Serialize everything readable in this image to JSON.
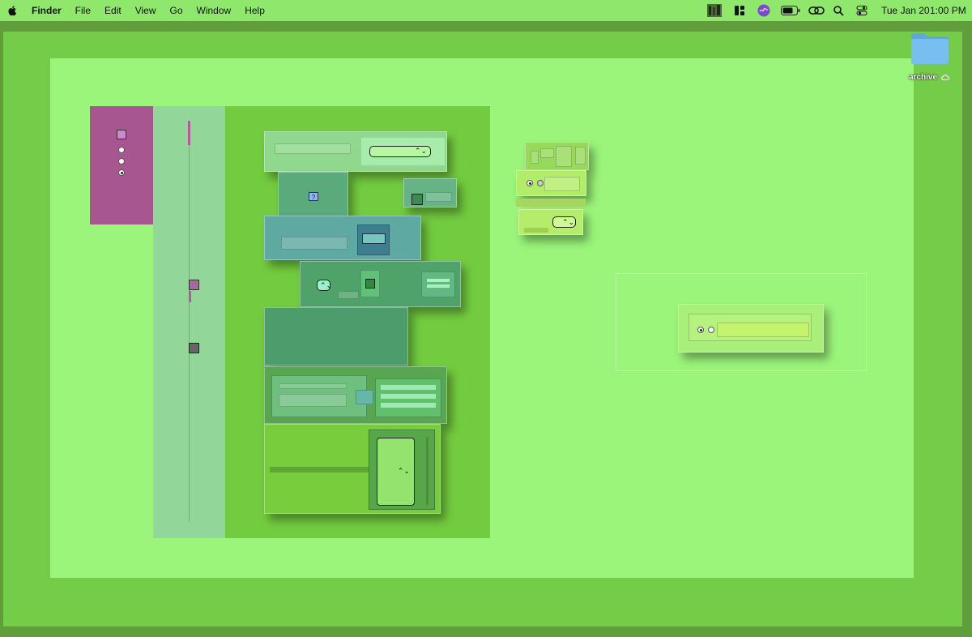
{
  "menubar": {
    "app_name": "Finder",
    "menus": [
      "File",
      "Edit",
      "View",
      "Go",
      "Window",
      "Help"
    ],
    "date": "Tue Jan 20",
    "time": "1:00 PM",
    "icons": [
      "apple-icon",
      "app-thumbnail-icon",
      "layout-icon",
      "siri-icon",
      "battery-icon",
      "link-icon",
      "search-icon",
      "control-center-icon"
    ]
  },
  "desktop": {
    "folder_label": "archive",
    "folder_badge_icon": "cloud-icon",
    "help_glyph": "?",
    "chevron_glyph": "⌃⌄"
  },
  "colors": {
    "menubar": "#8fe86b",
    "desktop_dark": "#5f9e3a",
    "desktop_mid": "#74cc49",
    "desktop_light": "#9bf57a",
    "accent_magenta": "#a8568f",
    "folder_blue": "#6fb7ec"
  }
}
